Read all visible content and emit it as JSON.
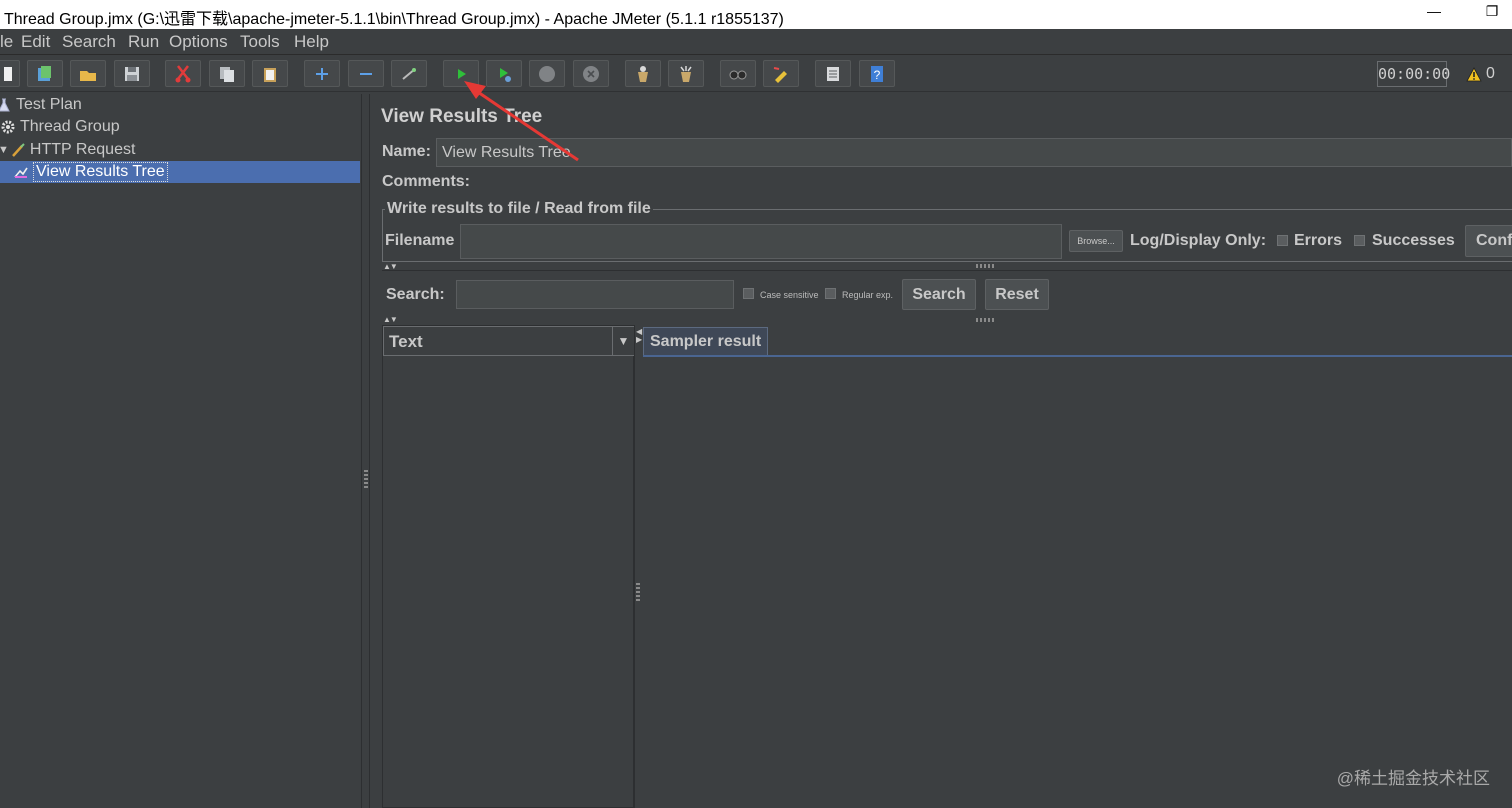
{
  "window": {
    "title": "Thread Group.jmx (G:\\迅雷下载\\apache-jmeter-5.1.1\\bin\\Thread Group.jmx) - Apache JMeter (5.1.1 r1855137)",
    "minimize_glyph": "—",
    "restore_glyph": "❐"
  },
  "menu": [
    "le",
    "Edit",
    "Search",
    "Run",
    "Options",
    "Tools",
    "Help"
  ],
  "toolbar": {
    "buttons": [
      "new-icon",
      "templates-icon",
      "open-icon",
      "save-icon",
      "cut-icon",
      "copy-icon",
      "paste-icon",
      "expand-icon",
      "collapse-icon",
      "toggle-icon",
      "start-icon",
      "start-no-pause-icon",
      "stop-icon",
      "shutdown-icon",
      "clear-icon",
      "clear-all-icon",
      "search-icon",
      "reset-search-icon",
      "function-helper-icon",
      "help-icon"
    ],
    "timer": "00:00:00",
    "warning_count": "0"
  },
  "tree": {
    "items": [
      {
        "label": "Test Plan",
        "icon": "test-plan-icon"
      },
      {
        "label": "Thread Group",
        "icon": "thread-group-icon"
      },
      {
        "label": "HTTP Request",
        "icon": "http-request-icon"
      },
      {
        "label": "View Results Tree",
        "icon": "listener-icon"
      }
    ],
    "selected": "View Results Tree"
  },
  "panel": {
    "title": "View Results Tree",
    "name_label": "Name:",
    "name_value": "View Results Tree",
    "comments_label": "Comments:",
    "file_legend": "Write results to file / Read from file",
    "filename_label": "Filename",
    "filename_value": "",
    "browse_label": "Browse...",
    "log_display_label": "Log/Display Only:",
    "errors_label": "Errors",
    "successes_label": "Successes",
    "configure_label": "Conf",
    "search_label": "Search:",
    "search_value": "",
    "case_sensitive_label": "Case sensitive",
    "regular_exp_label": "Regular exp.",
    "search_button": "Search",
    "reset_button": "Reset",
    "renderer_selected": "Text",
    "tab_label": "Sampler result"
  },
  "watermark": "@稀土掘金技术社区",
  "colors": {
    "background": "#3c3f41",
    "selection": "#4b6eaf",
    "annotation_arrow": "#e53935"
  }
}
